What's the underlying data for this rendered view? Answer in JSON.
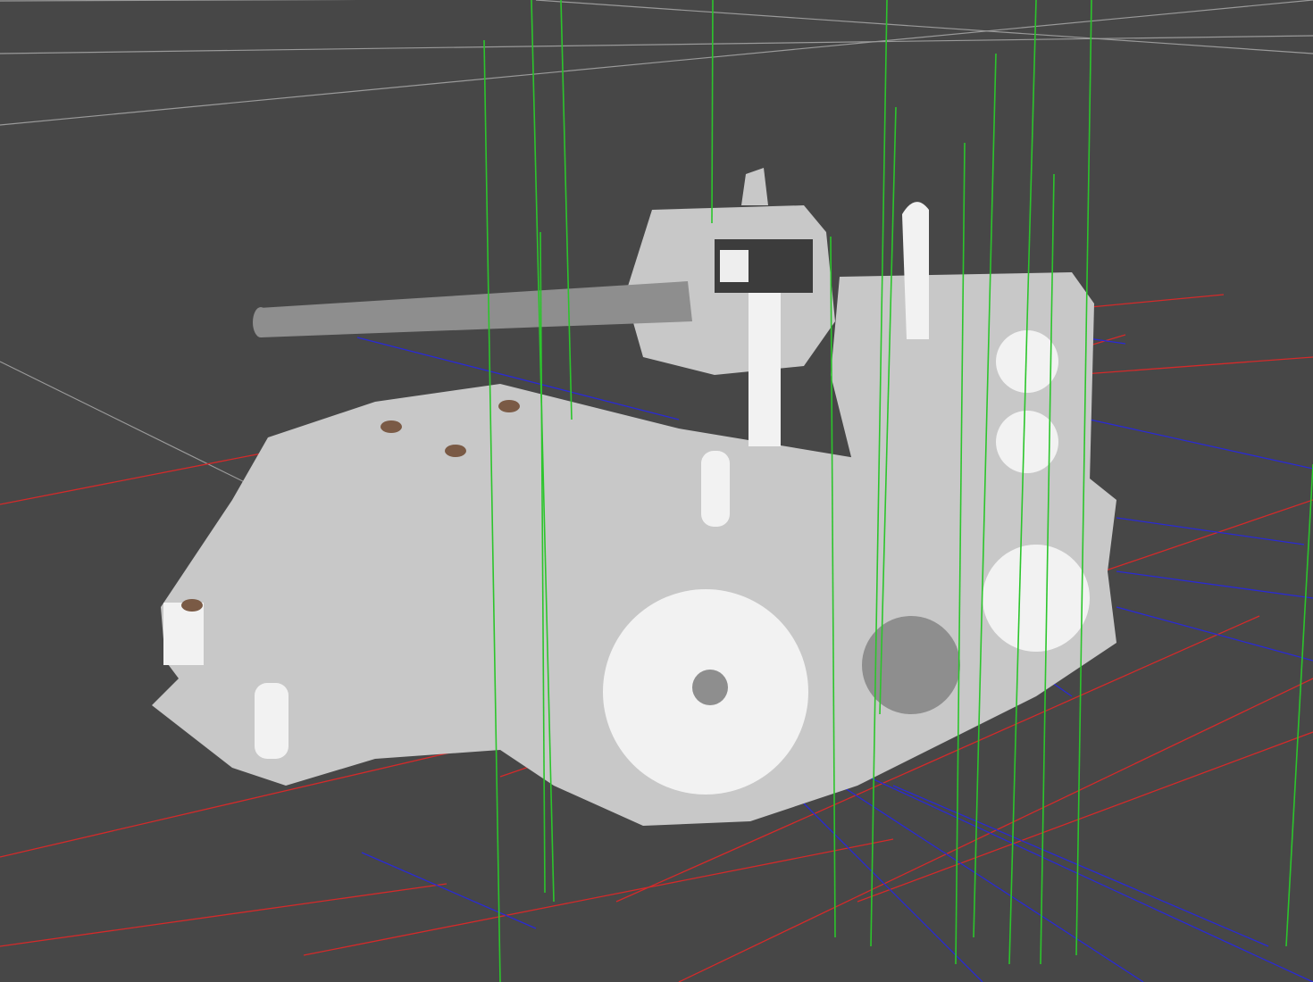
{
  "viewport": {
    "background_color": "#474747",
    "grid_color": "#9a9a9a",
    "model_color": "#c8c8c8",
    "model_highlight_color": "#f2f2f2",
    "model_shadow_color": "#8e8e8e",
    "accent_brown": "#7a5a45",
    "axis_colors": {
      "x": "#d42a2a",
      "y": "#2cc52c",
      "z": "#2a2ad4"
    }
  }
}
